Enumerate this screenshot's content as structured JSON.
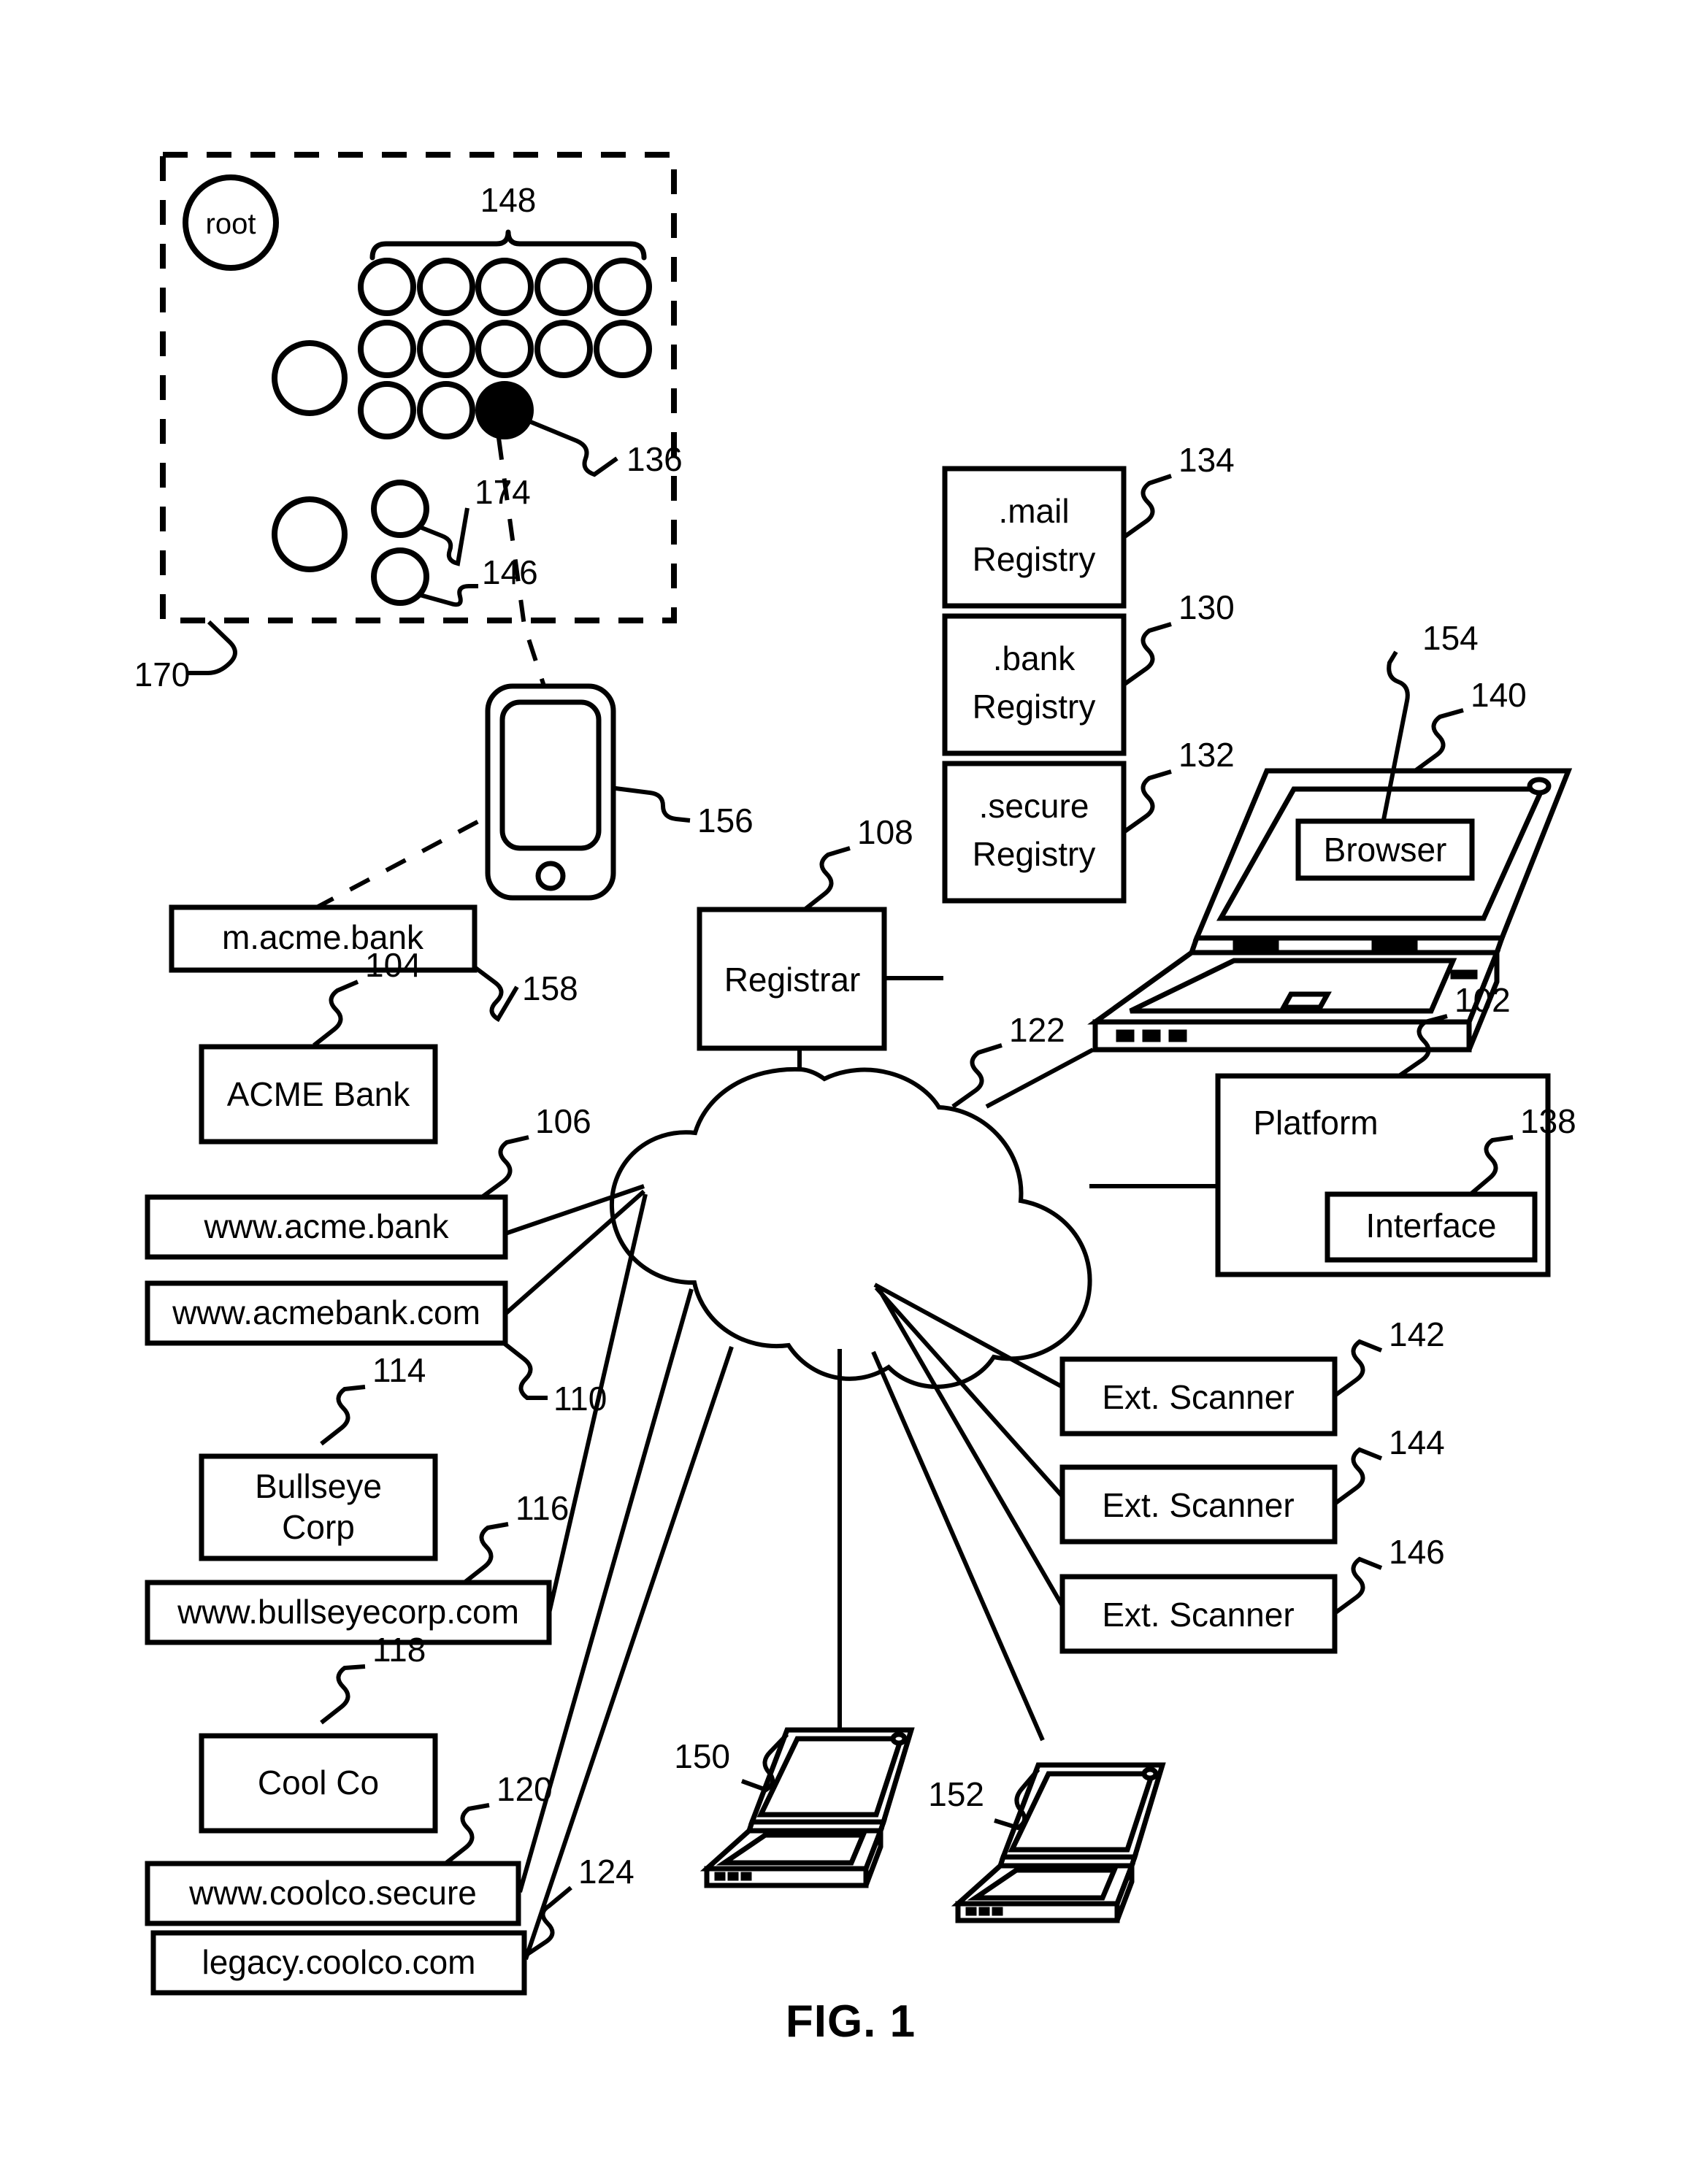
{
  "figure": {
    "caption": "FIG. 1",
    "dns_tree": {
      "root_label": "root",
      "group_ref": "148",
      "container_ref": "170",
      "selected_node_ref": "136",
      "node_174_ref": "174",
      "node_146_ref": "146"
    },
    "nodes": {
      "platform": {
        "label": "Platform",
        "ref": "102"
      },
      "interface": {
        "label": "Interface",
        "ref": "138"
      },
      "acme_bank": {
        "label": "ACME Bank",
        "ref": "104"
      },
      "www_acme_bank": {
        "label": "www.acme.bank",
        "ref": "106"
      },
      "registrar": {
        "label": "Registrar",
        "ref": "108"
      },
      "www_acmebank_com": {
        "label": "www.acmebank.com",
        "ref": "110"
      },
      "bullseye_corp": {
        "label": "Bullseye Corp",
        "ref": "114"
      },
      "www_bullseyecorp_com": {
        "label": "www.bullseyecorp.com",
        "ref": "116"
      },
      "cool_co": {
        "label": "Cool Co",
        "ref": "118"
      },
      "www_coolco_secure": {
        "label": "www.coolco.secure",
        "ref": "120"
      },
      "network_cloud": {
        "label": "",
        "ref": "122"
      },
      "legacy_coolco_com": {
        "label": "legacy.coolco.com",
        "ref": "124"
      },
      "bank_registry": {
        "label": ".bank Registry",
        "line1": ".bank",
        "line2": "Registry",
        "ref": "130"
      },
      "secure_registry": {
        "label": ".secure Registry",
        "line1": ".secure",
        "line2": "Registry",
        "ref": "132"
      },
      "mail_registry": {
        "label": ".mail Registry",
        "line1": ".mail",
        "line2": "Registry",
        "ref": "134"
      },
      "laptop_main": {
        "label": "",
        "ref": "140"
      },
      "browser": {
        "label": "Browser",
        "ref": "154"
      },
      "ext_scanner_1": {
        "label": "Ext. Scanner",
        "ref": "142"
      },
      "ext_scanner_2": {
        "label": "Ext. Scanner",
        "ref": "144"
      },
      "ext_scanner_3": {
        "label": "Ext. Scanner",
        "ref": "146"
      },
      "client_laptop_1": {
        "label": "",
        "ref": "150"
      },
      "client_laptop_2": {
        "label": "",
        "ref": "152"
      },
      "smartphone": {
        "label": "",
        "ref": "156"
      },
      "m_acme_bank": {
        "label": "m.acme.bank",
        "ref": "158"
      },
      "bullseye_corp_line1": "Bullseye",
      "bullseye_corp_line2": "Corp"
    },
    "colors": {
      "ink": "#000000",
      "paper": "#ffffff"
    }
  }
}
